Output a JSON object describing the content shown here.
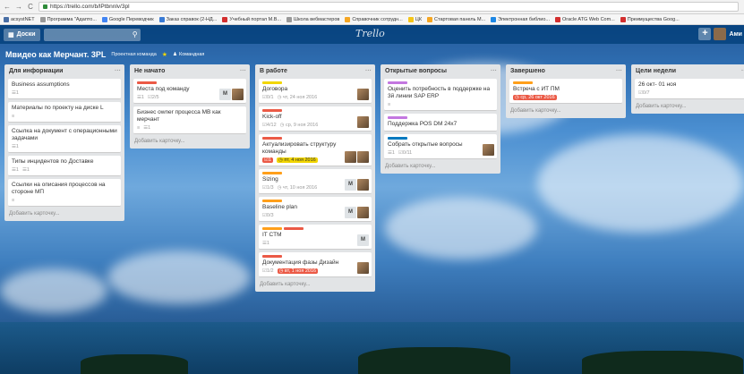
{
  "browser": {
    "url": "https://trello.com/b/lPtbnnlv/3pl",
    "bookmarks": [
      {
        "label": "acsystNET",
        "color": "#4a6fa5"
      },
      {
        "label": "Программа \"Адапто...",
        "color": "#999999"
      },
      {
        "label": "Google Переводчик",
        "color": "#4285f4"
      },
      {
        "label": "Заказ справок (2-НД...",
        "color": "#3a7bd5"
      },
      {
        "label": "Учебный портал М.В...",
        "color": "#d32f2f"
      },
      {
        "label": "Школа вебмастеров",
        "color": "#999999"
      },
      {
        "label": "Справочник сотрудн...",
        "color": "#f5a623"
      },
      {
        "label": "ЦК",
        "color": "#f5c518"
      },
      {
        "label": "Стартовая панель М...",
        "color": "#f5a623"
      },
      {
        "label": "Электронная библио...",
        "color": "#1e88e5"
      },
      {
        "label": "Oracle ATG Web Com...",
        "color": "#d32f2f"
      },
      {
        "label": "Преимущества Goog...",
        "color": "#d32f2f"
      }
    ]
  },
  "header": {
    "boards_label": "Доски",
    "logo": "Trello",
    "user_name": "Ами"
  },
  "board": {
    "title": "Мвидео как Мерчант. 3PL",
    "team": "Проектная команда",
    "visibility": "Командная"
  },
  "colors": {
    "green": "#61bd4f",
    "yellow": "#f2d600",
    "orange": "#ff9f1a",
    "red": "#eb5a46",
    "purple": "#c377e0",
    "blue": "#0079bf"
  },
  "lists": [
    {
      "name": "Для информации",
      "add_card": "Добавить карточку...",
      "cards": [
        {
          "title": "Business assumptions",
          "badges": [
            "☰1"
          ]
        },
        {
          "title": "Материалы по проекту на диске L",
          "badges": [
            "≡"
          ]
        },
        {
          "title": "Ссылка на документ с операционными задачами",
          "badges": [
            "☰1"
          ]
        },
        {
          "title": "Типы инцидентов по Доставке",
          "badges": [
            "☰1",
            "☰1"
          ]
        },
        {
          "title": "Ссылки на описания процессов на стороне МП",
          "badges": [
            "≡"
          ]
        }
      ]
    },
    {
      "name": "Не начато",
      "add_card": "Добавить карточку...",
      "cards": [
        {
          "title": "Места под команду",
          "labels": [
            "red"
          ],
          "badges": [
            "☰1",
            "☑2/5"
          ],
          "members": [
            "M",
            "photo"
          ]
        },
        {
          "title": "Бизнес owner процесса МВ как мерчант",
          "badges": [
            "≡",
            "☰1"
          ]
        }
      ]
    },
    {
      "name": "В работе",
      "add_card": "Добавить карточку...",
      "cards": [
        {
          "title": "Договора",
          "labels": [
            "yellow"
          ],
          "badges": [
            "☑0/1",
            "◷ чт, 24 ноя 2016"
          ],
          "members": [
            "photo"
          ]
        },
        {
          "title": "Kick-off",
          "labels": [
            "red"
          ],
          "badges": [
            "☑4/12",
            "◷ ср, 9 ноя 2016"
          ],
          "members": [
            "photo"
          ]
        },
        {
          "title": "Актуализировать структуру команды",
          "labels": [
            "red"
          ],
          "due": "◷ пт, 4 ноя 2016",
          "badges_lead": "☑1",
          "members": [
            "photo",
            "photo"
          ]
        },
        {
          "title": "Sizing",
          "labels": [
            "orange"
          ],
          "badges": [
            "☑1/3",
            "◷ чт, 10 ноя 2016"
          ],
          "members": [
            "M",
            "photo"
          ]
        },
        {
          "title": "Baseline plan",
          "labels": [
            "orange"
          ],
          "badges": [
            "☑0/3"
          ],
          "members": [
            "M",
            "photo"
          ]
        },
        {
          "title": "IT CTM",
          "labels": [
            "orange",
            "red"
          ],
          "badges": [
            "☰1"
          ],
          "members": [
            "M"
          ]
        },
        {
          "title": "Документация фазы Дизайн",
          "labels": [
            "red"
          ],
          "badges": [
            "☑1/2"
          ],
          "due": "◷ вт, 1 ноя 2016",
          "members": [
            "photo"
          ]
        }
      ]
    },
    {
      "name": "Открытые вопросы",
      "add_card": "Добавить карточку...",
      "cards": [
        {
          "title": "Оценить потребность в поддержке на 3й линии SAP ERP",
          "labels": [
            "purple"
          ],
          "badges": [
            "≡"
          ]
        },
        {
          "title": "Поддержка POS DM 24x7",
          "labels": [
            "purple"
          ],
          "badges": []
        },
        {
          "title": "Собрать открытые вопросы",
          "labels": [
            "blue"
          ],
          "badges": [
            "☰1",
            "☑0/11"
          ],
          "members": [
            "photo"
          ]
        }
      ]
    },
    {
      "name": "Завершено",
      "add_card": "Добавить карточку...",
      "cards": [
        {
          "title": "Встреча с ИТ ПМ",
          "labels": [
            "orange"
          ],
          "due": "◷ ср, 26 окт 2016",
          "badges": []
        }
      ]
    },
    {
      "name": "Цели недели",
      "add_card": "Добавить карточку...",
      "cards": [
        {
          "title": "26 окт- 01 ноя",
          "badges": [
            "☑0/7"
          ]
        }
      ]
    }
  ]
}
